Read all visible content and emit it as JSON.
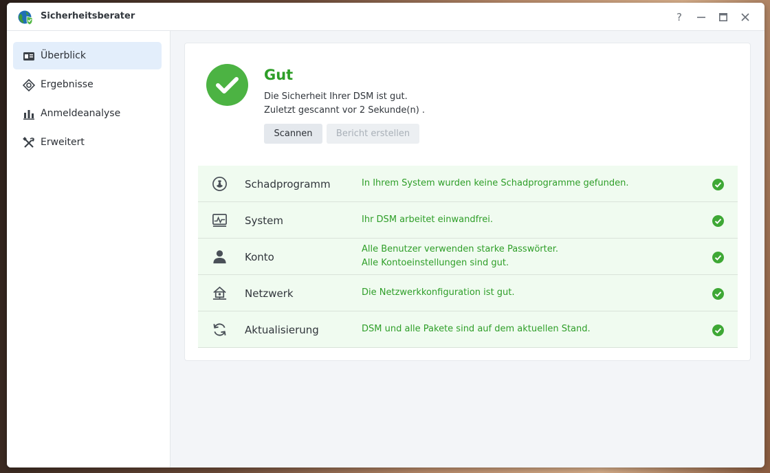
{
  "window": {
    "title": "Sicherheitsberater",
    "controls": [
      "?",
      "–",
      "□",
      "✕"
    ]
  },
  "sidebar": {
    "items": [
      {
        "label": "Überblick",
        "icon": "overview-card-icon",
        "active": true
      },
      {
        "label": "Ergebnisse",
        "icon": "crosshair-icon",
        "active": false
      },
      {
        "label": "Anmeldeanalyse",
        "icon": "bar-chart-icon",
        "active": false
      },
      {
        "label": "Erweitert",
        "icon": "tools-icon",
        "active": false
      }
    ]
  },
  "status": {
    "title": "Gut",
    "line1": "Die Sicherheit Ihrer DSM ist gut.",
    "line2": "Zuletzt gescannt vor 2 Sekunde(n) .",
    "scan_button": "Scannen",
    "report_button": "Bericht erstellen"
  },
  "categories": [
    {
      "name": "Schadprogramm",
      "icon": "radiation-icon",
      "messages": [
        "In Ihrem System wurden keine Schadprogramme gefunden."
      ]
    },
    {
      "name": "System",
      "icon": "system-monitor-icon",
      "messages": [
        "Ihr DSM arbeitet einwandfrei."
      ]
    },
    {
      "name": "Konto",
      "icon": "user-icon",
      "messages": [
        "Alle Benutzer verwenden starke Passwörter.",
        "Alle Kontoeinstellungen sind gut."
      ]
    },
    {
      "name": "Netzwerk",
      "icon": "network-home-icon",
      "messages": [
        "Die Netzwerkkonfiguration ist gut."
      ]
    },
    {
      "name": "Aktualisierung",
      "icon": "refresh-icon",
      "messages": [
        "DSM und alle Pakete sind auf dem aktuellen Stand."
      ]
    }
  ],
  "colors": {
    "accent_green": "#2e9e28",
    "status_green": "#4cb343",
    "row_background": "#f0fbf0",
    "active_nav": "#e3eefb"
  }
}
